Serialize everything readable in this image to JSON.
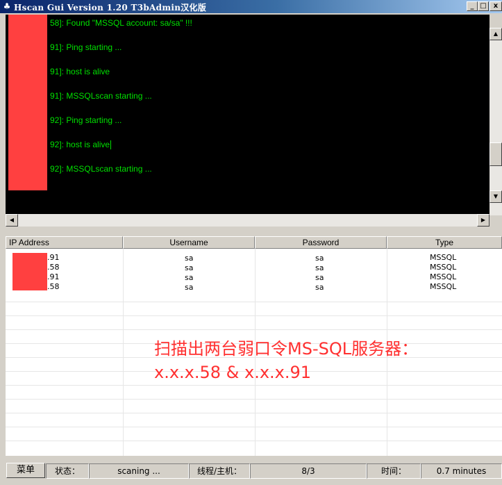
{
  "window": {
    "title": "Hscan Gui Version 1.20 T3bAdmin汉化版",
    "buttons": {
      "minimize": "_",
      "maximize": "□",
      "close": "x"
    }
  },
  "log": {
    "lines": [
      "58]: Found \"MSSQL account: sa/sa\" !!!",
      "91]: Ping starting ...",
      "91]: host is alive",
      "91]: MSSQLscan starting ...",
      "92]: Ping starting ...",
      "92]: host is alive",
      "92]: MSSQLscan starting ..."
    ]
  },
  "table": {
    "columns": [
      "IP Address",
      "Username",
      "Password",
      "Type"
    ],
    "rows": [
      {
        "ip": ".91",
        "username": "sa",
        "password": "sa",
        "type": "MSSQL"
      },
      {
        "ip": ".58",
        "username": "sa",
        "password": "sa",
        "type": "MSSQL"
      },
      {
        "ip": ".91",
        "username": "sa",
        "password": "sa",
        "type": "MSSQL"
      },
      {
        "ip": ".58",
        "username": "sa",
        "password": "sa",
        "type": "MSSQL"
      }
    ]
  },
  "annotation": {
    "line1": "扫描出两台弱口令MS-SQL服务器：",
    "line2": "x.x.x.58 & x.x.x.91",
    "color": "#ff3030"
  },
  "status": {
    "menu_label": "菜单",
    "state_label": "状态：",
    "state_value": "scaning ...",
    "threads_label": "线程/主机：",
    "threads_value": "8/3",
    "time_label": "时间：",
    "time_value": "0.7 minutes"
  },
  "colors": {
    "console_text": "#00e000",
    "redaction": "#ff4040"
  }
}
